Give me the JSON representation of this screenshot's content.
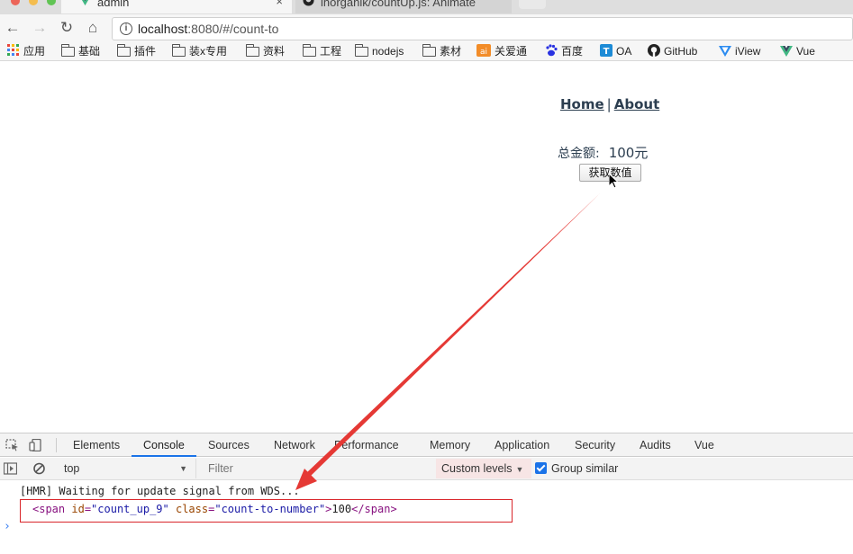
{
  "browser": {
    "tabs": [
      {
        "title": "admin",
        "close": "×"
      },
      {
        "title": "inorganik/countUp.js: Animate"
      }
    ],
    "url": {
      "host": "localhost",
      "path": ":8080/#/count-to"
    },
    "nav": {
      "back": "←",
      "forward": "→",
      "reload": "↻",
      "home": "⌂"
    }
  },
  "bookmarks": [
    {
      "label": "应用",
      "icon": "apps-icon"
    },
    {
      "label": "基础",
      "icon": "folder-icon"
    },
    {
      "label": "插件",
      "icon": "folder-icon"
    },
    {
      "label": "装x专用",
      "icon": "folder-icon"
    },
    {
      "label": "资料",
      "icon": "folder-icon"
    },
    {
      "label": "工程",
      "icon": "folder-icon"
    },
    {
      "label": "nodejs",
      "icon": "folder-icon"
    },
    {
      "label": "素材",
      "icon": "folder-icon"
    },
    {
      "label": "关爱通",
      "icon": "guanaitong-icon"
    },
    {
      "label": "百度",
      "icon": "baidu-icon"
    },
    {
      "label": "OA",
      "icon": "oa-icon"
    },
    {
      "label": "GitHub",
      "icon": "github-icon"
    },
    {
      "label": "iView",
      "icon": "iview-icon"
    },
    {
      "label": "Vue",
      "icon": "vue-icon"
    }
  ],
  "page": {
    "nav": {
      "home": "Home",
      "separator": "|",
      "about": "About"
    },
    "total_label": "总金额:",
    "total_value": "100元",
    "get_button": "获取数值"
  },
  "devtools": {
    "tabs": [
      "Elements",
      "Console",
      "Sources",
      "Network",
      "Performance",
      "Memory",
      "Application",
      "Security",
      "Audits",
      "Vue"
    ],
    "active_tab": "Console",
    "context": "top",
    "filter_placeholder": "Filter",
    "levels": "Custom levels",
    "group_similar": "Group similar",
    "console": {
      "line1": "[HMR] Waiting for update signal from WDS...",
      "element": {
        "open_tag_start": "<span ",
        "attr1_name": "id",
        "attr1_value": "\"count_up_9\"",
        "attr2_name": "class",
        "attr2_value": "\"count-to-number\"",
        "open_tag_end": ">",
        "text": "100",
        "close_tag": "</span>"
      },
      "prompt": "›"
    }
  },
  "colors": {
    "accent_blue": "#1a73e8",
    "annotation_red": "#e53935",
    "page_text": "#2c3e50"
  }
}
